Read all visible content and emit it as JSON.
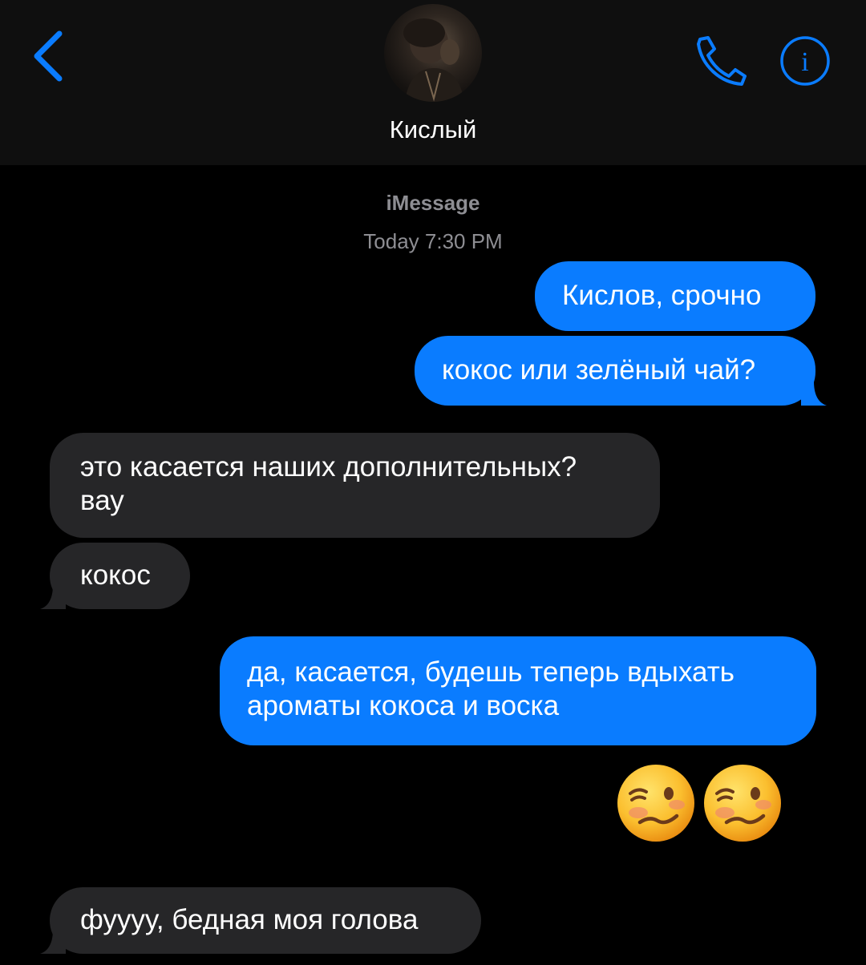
{
  "header": {
    "back_icon": "chevron-left-icon",
    "contact_name": "Кислый",
    "call_icon": "phone-icon",
    "info_icon": "info-icon",
    "info_glyph": "i",
    "accent_color": "#0a7cff"
  },
  "thread": {
    "service": "iMessage",
    "timestamp": "Today 7:30 PM"
  },
  "messages": [
    {
      "direction": "outgoing",
      "text": "Кислов, срочно"
    },
    {
      "direction": "outgoing",
      "text": "кокос или зелёный чай?"
    },
    {
      "direction": "incoming",
      "lines": [
        "это касается наших дополнительных?",
        "вау"
      ]
    },
    {
      "direction": "incoming",
      "text": "кокос"
    },
    {
      "direction": "outgoing",
      "lines": [
        "да, касается, будешь теперь вдыхать",
        "ароматы кокоса и воска"
      ]
    },
    {
      "direction": "outgoing",
      "emoji": [
        "woozy-face-emoji",
        "woozy-face-emoji"
      ]
    },
    {
      "direction": "incoming",
      "text": "фуууу, бедная моя голова"
    }
  ],
  "colors": {
    "background": "#000000",
    "header_background": "#0f0f0f",
    "outgoing_bubble": "#0a7cff",
    "incoming_bubble": "#262628",
    "meta_text": "#8e8e93"
  }
}
